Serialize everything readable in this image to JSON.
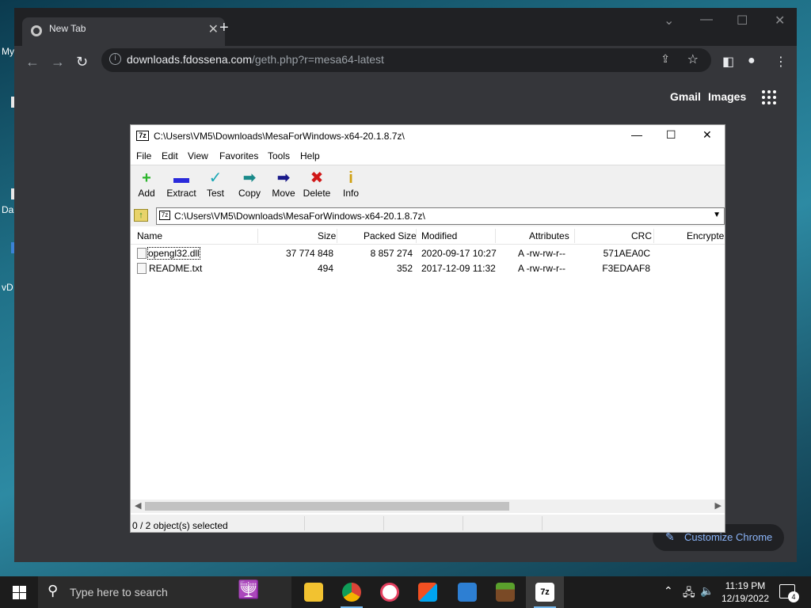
{
  "desktop": {
    "frag_my": "My",
    "frag_da": "Da",
    "frag_v": "vD"
  },
  "chrome": {
    "tab_title": "New Tab",
    "tab_close": "✕",
    "new_tab": "+",
    "url_domain": "downloads.fdossena.com",
    "url_path": "/geth.php?r=mesa64-latest",
    "gmail": "Gmail",
    "images": "Images",
    "customize": "Customize Chrome"
  },
  "sevenzip": {
    "title": "C:\\Users\\VM5\\Downloads\\MesaForWindows-x64-20.1.8.7z\\",
    "logo": "7z",
    "menu": [
      "File",
      "Edit",
      "View",
      "Favorites",
      "Tools",
      "Help"
    ],
    "toolbar": [
      {
        "label": "Add",
        "icon": "+",
        "color": "#2bb52b"
      },
      {
        "label": "Extract",
        "icon": "▬",
        "color": "#2a2adb"
      },
      {
        "label": "Test",
        "icon": "✓",
        "color": "#1aa7b5"
      },
      {
        "label": "Copy",
        "icon": "➡",
        "color": "#1a8a8a"
      },
      {
        "label": "Move",
        "icon": "➡",
        "color": "#1a1a8a"
      },
      {
        "label": "Delete",
        "icon": "✖",
        "color": "#d01818"
      },
      {
        "label": "Info",
        "icon": "i",
        "color": "#d0a010"
      }
    ],
    "address": "C:\\Users\\VM5\\Downloads\\MesaForWindows-x64-20.1.8.7z\\",
    "columns": [
      "Name",
      "Size",
      "Packed Size",
      "Modified",
      "Attributes",
      "CRC",
      "Encrypte"
    ],
    "rows": [
      {
        "name": "opengl32.dll",
        "size": "37 774 848",
        "packed": "8 857 274",
        "modified": "2020-09-17 10:27",
        "attributes": "A -rw-rw-r--",
        "crc": "571AEA0C"
      },
      {
        "name": "README.txt",
        "size": "494",
        "packed": "352",
        "modified": "2017-12-09 11:32",
        "attributes": "A -rw-rw-r--",
        "crc": "F3EDAAF8"
      }
    ],
    "status": "0 / 2 object(s) selected"
  },
  "taskbar": {
    "search_placeholder": "Type here to search",
    "time": "11:19 PM",
    "date": "12/19/2022",
    "notifications": "4"
  }
}
